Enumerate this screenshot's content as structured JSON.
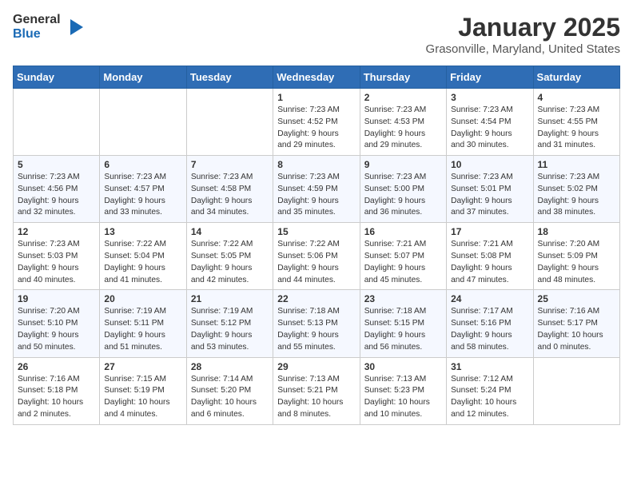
{
  "logo": {
    "line1": "General",
    "line2": "Blue"
  },
  "title": "January 2025",
  "subtitle": "Grasonville, Maryland, United States",
  "weekdays": [
    "Sunday",
    "Monday",
    "Tuesday",
    "Wednesday",
    "Thursday",
    "Friday",
    "Saturday"
  ],
  "weeks": [
    [
      {
        "day": "",
        "info": ""
      },
      {
        "day": "",
        "info": ""
      },
      {
        "day": "",
        "info": ""
      },
      {
        "day": "1",
        "info": "Sunrise: 7:23 AM\nSunset: 4:52 PM\nDaylight: 9 hours\nand 29 minutes."
      },
      {
        "day": "2",
        "info": "Sunrise: 7:23 AM\nSunset: 4:53 PM\nDaylight: 9 hours\nand 29 minutes."
      },
      {
        "day": "3",
        "info": "Sunrise: 7:23 AM\nSunset: 4:54 PM\nDaylight: 9 hours\nand 30 minutes."
      },
      {
        "day": "4",
        "info": "Sunrise: 7:23 AM\nSunset: 4:55 PM\nDaylight: 9 hours\nand 31 minutes."
      }
    ],
    [
      {
        "day": "5",
        "info": "Sunrise: 7:23 AM\nSunset: 4:56 PM\nDaylight: 9 hours\nand 32 minutes."
      },
      {
        "day": "6",
        "info": "Sunrise: 7:23 AM\nSunset: 4:57 PM\nDaylight: 9 hours\nand 33 minutes."
      },
      {
        "day": "7",
        "info": "Sunrise: 7:23 AM\nSunset: 4:58 PM\nDaylight: 9 hours\nand 34 minutes."
      },
      {
        "day": "8",
        "info": "Sunrise: 7:23 AM\nSunset: 4:59 PM\nDaylight: 9 hours\nand 35 minutes."
      },
      {
        "day": "9",
        "info": "Sunrise: 7:23 AM\nSunset: 5:00 PM\nDaylight: 9 hours\nand 36 minutes."
      },
      {
        "day": "10",
        "info": "Sunrise: 7:23 AM\nSunset: 5:01 PM\nDaylight: 9 hours\nand 37 minutes."
      },
      {
        "day": "11",
        "info": "Sunrise: 7:23 AM\nSunset: 5:02 PM\nDaylight: 9 hours\nand 38 minutes."
      }
    ],
    [
      {
        "day": "12",
        "info": "Sunrise: 7:23 AM\nSunset: 5:03 PM\nDaylight: 9 hours\nand 40 minutes."
      },
      {
        "day": "13",
        "info": "Sunrise: 7:22 AM\nSunset: 5:04 PM\nDaylight: 9 hours\nand 41 minutes."
      },
      {
        "day": "14",
        "info": "Sunrise: 7:22 AM\nSunset: 5:05 PM\nDaylight: 9 hours\nand 42 minutes."
      },
      {
        "day": "15",
        "info": "Sunrise: 7:22 AM\nSunset: 5:06 PM\nDaylight: 9 hours\nand 44 minutes."
      },
      {
        "day": "16",
        "info": "Sunrise: 7:21 AM\nSunset: 5:07 PM\nDaylight: 9 hours\nand 45 minutes."
      },
      {
        "day": "17",
        "info": "Sunrise: 7:21 AM\nSunset: 5:08 PM\nDaylight: 9 hours\nand 47 minutes."
      },
      {
        "day": "18",
        "info": "Sunrise: 7:20 AM\nSunset: 5:09 PM\nDaylight: 9 hours\nand 48 minutes."
      }
    ],
    [
      {
        "day": "19",
        "info": "Sunrise: 7:20 AM\nSunset: 5:10 PM\nDaylight: 9 hours\nand 50 minutes."
      },
      {
        "day": "20",
        "info": "Sunrise: 7:19 AM\nSunset: 5:11 PM\nDaylight: 9 hours\nand 51 minutes."
      },
      {
        "day": "21",
        "info": "Sunrise: 7:19 AM\nSunset: 5:12 PM\nDaylight: 9 hours\nand 53 minutes."
      },
      {
        "day": "22",
        "info": "Sunrise: 7:18 AM\nSunset: 5:13 PM\nDaylight: 9 hours\nand 55 minutes."
      },
      {
        "day": "23",
        "info": "Sunrise: 7:18 AM\nSunset: 5:15 PM\nDaylight: 9 hours\nand 56 minutes."
      },
      {
        "day": "24",
        "info": "Sunrise: 7:17 AM\nSunset: 5:16 PM\nDaylight: 9 hours\nand 58 minutes."
      },
      {
        "day": "25",
        "info": "Sunrise: 7:16 AM\nSunset: 5:17 PM\nDaylight: 10 hours\nand 0 minutes."
      }
    ],
    [
      {
        "day": "26",
        "info": "Sunrise: 7:16 AM\nSunset: 5:18 PM\nDaylight: 10 hours\nand 2 minutes."
      },
      {
        "day": "27",
        "info": "Sunrise: 7:15 AM\nSunset: 5:19 PM\nDaylight: 10 hours\nand 4 minutes."
      },
      {
        "day": "28",
        "info": "Sunrise: 7:14 AM\nSunset: 5:20 PM\nDaylight: 10 hours\nand 6 minutes."
      },
      {
        "day": "29",
        "info": "Sunrise: 7:13 AM\nSunset: 5:21 PM\nDaylight: 10 hours\nand 8 minutes."
      },
      {
        "day": "30",
        "info": "Sunrise: 7:13 AM\nSunset: 5:23 PM\nDaylight: 10 hours\nand 10 minutes."
      },
      {
        "day": "31",
        "info": "Sunrise: 7:12 AM\nSunset: 5:24 PM\nDaylight: 10 hours\nand 12 minutes."
      },
      {
        "day": "",
        "info": ""
      }
    ]
  ]
}
